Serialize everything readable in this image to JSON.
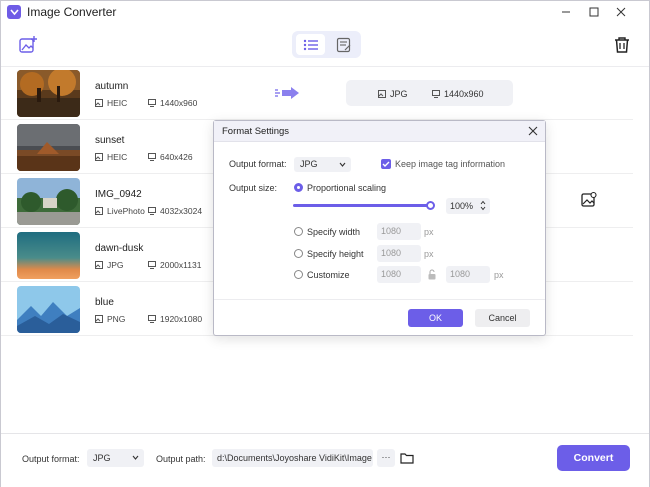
{
  "app": {
    "title": "Image Converter"
  },
  "files": [
    {
      "name": "autumn",
      "format": "HEIC",
      "size": "1440x960"
    },
    {
      "name": "sunset",
      "format": "HEIC",
      "size": "640x426"
    },
    {
      "name": "IMG_0942",
      "format": "LivePhoto",
      "size": "4032x3024"
    },
    {
      "name": "dawn-dusk",
      "format": "JPG",
      "size": "2000x1131"
    },
    {
      "name": "blue",
      "format": "PNG",
      "size": "1920x1080"
    }
  ],
  "output_preview": {
    "format": "JPG",
    "size": "1440x960"
  },
  "dialog": {
    "title": "Format Settings",
    "output_format_label": "Output format:",
    "output_format_value": "JPG",
    "keep_tag_label": "Keep image tag information",
    "keep_tag_checked": true,
    "output_size_label": "Output size:",
    "proportional_label": "Proportional scaling",
    "scale_percent": "100%",
    "scale_fraction": 1.0,
    "specify_width_label": "Specify width",
    "specify_width_value": "1080",
    "specify_height_label": "Specify height",
    "specify_height_value": "1080",
    "customize_label": "Customize",
    "customize_width": "1080",
    "customize_height": "1080",
    "unit": "px",
    "ok_label": "OK",
    "cancel_label": "Cancel"
  },
  "bottom": {
    "output_format_label": "Output format:",
    "output_format_value": "JPG",
    "output_path_label": "Output path:",
    "output_path_value": "d:\\Documents\\Joyoshare VidiKit\\Image",
    "more_label": "···",
    "convert_label": "Convert"
  },
  "colors": {
    "accent": "#6c5ee8"
  }
}
